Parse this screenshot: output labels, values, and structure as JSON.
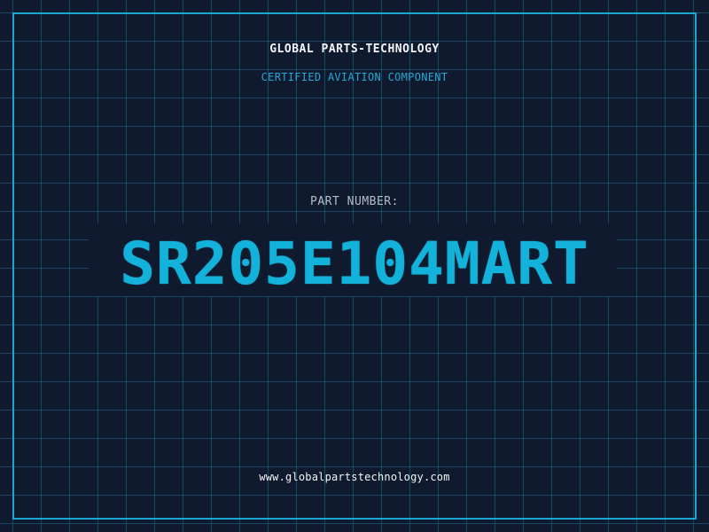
{
  "header": {
    "company": "GLOBAL PARTS-TECHNOLOGY",
    "tagline": "CERTIFIED AVIATION COMPONENT"
  },
  "part": {
    "label": "PART NUMBER:",
    "number": "SR205E104MART"
  },
  "footer": {
    "url": "www.globalpartstechnology.com"
  },
  "colors": {
    "background": "#101a2e",
    "grid": "#1e6e8c",
    "frame": "#1aa6cf",
    "accent": "#12b2db",
    "text": "#f2f4f7",
    "muted": "#b5bdc8"
  }
}
